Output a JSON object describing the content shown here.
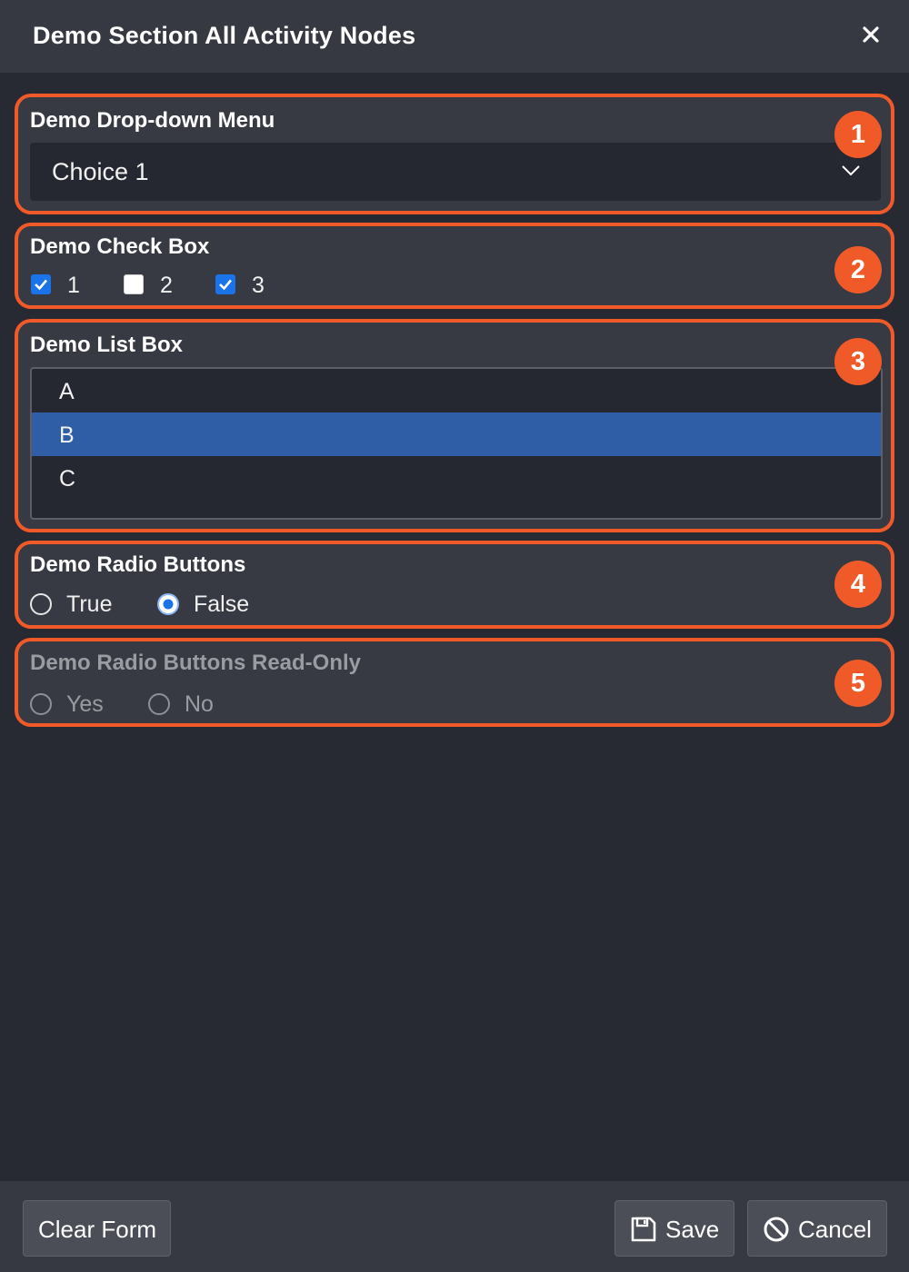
{
  "dialog": {
    "title": "Demo Section All Activity Nodes",
    "close_icon": "close-icon"
  },
  "sections": {
    "dropdown": {
      "label": "Demo Drop-down Menu",
      "value": "Choice 1",
      "badge": "1"
    },
    "checkbox": {
      "label": "Demo Check Box",
      "badge": "2",
      "options": [
        {
          "label": "1",
          "checked": true
        },
        {
          "label": "2",
          "checked": false
        },
        {
          "label": "3",
          "checked": true
        }
      ]
    },
    "listbox": {
      "label": "Demo List Box",
      "badge": "3",
      "items": [
        "A",
        "B",
        "C"
      ],
      "selected": "B"
    },
    "radio": {
      "label": "Demo Radio Buttons",
      "badge": "4",
      "options": [
        "True",
        "False"
      ],
      "selected": "False"
    },
    "radio_readonly": {
      "label": "Demo Radio Buttons Read-Only",
      "badge": "5",
      "options": [
        "Yes",
        "No"
      ],
      "selected": null
    }
  },
  "footer": {
    "clear_label": "Clear Form",
    "save_label": "Save",
    "cancel_label": "Cancel"
  },
  "colors": {
    "accent_annotation": "#f05a28",
    "selection": "#2f5ea6",
    "checkbox_checked": "#1a73e8"
  }
}
